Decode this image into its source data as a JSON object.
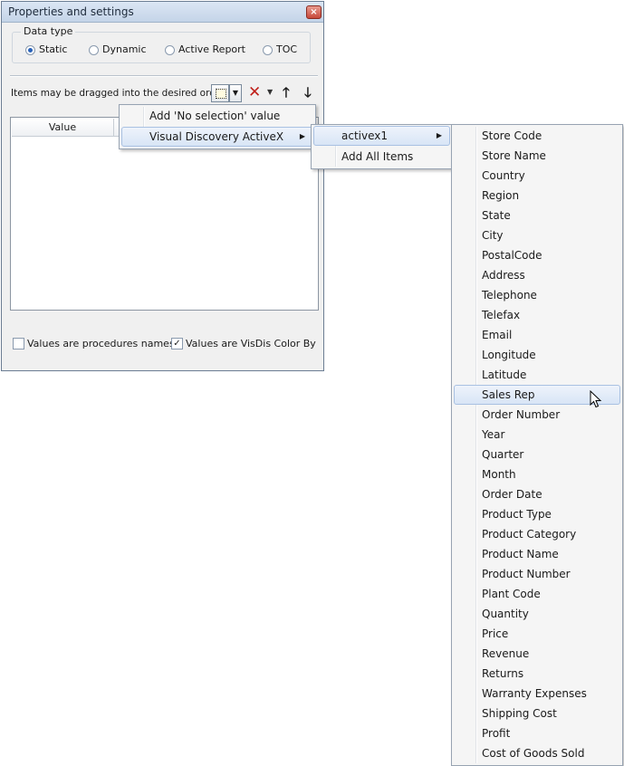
{
  "dialog": {
    "title": "Properties and settings",
    "close_glyph": "×",
    "data_type": {
      "label": "Data type",
      "options": [
        {
          "label": "Static",
          "selected": true
        },
        {
          "label": "Dynamic",
          "selected": false
        },
        {
          "label": "Active Report",
          "selected": false
        },
        {
          "label": "TOC",
          "selected": false
        }
      ]
    },
    "hint": "Items may be dragged into the desired order",
    "toolbar": {
      "add_icon": "add-item-icon",
      "dropdown_glyph": "▼",
      "delete_glyph": "✕",
      "delete_arrow_glyph": "▼",
      "up_glyph": "🡑",
      "down_glyph": "🡓"
    },
    "grid": {
      "column_value": "Value"
    },
    "checkbox_procedures": {
      "label": "Values are procedures names",
      "checked": false
    },
    "checkbox_visdis": {
      "label": "Values are VisDis Color By",
      "checked": true,
      "check_glyph": "✓"
    }
  },
  "menu1": {
    "items": [
      {
        "label": "Add 'No selection' value",
        "has_submenu": false,
        "highlighted": false
      },
      {
        "label": "Visual Discovery ActiveX",
        "has_submenu": true,
        "highlighted": true
      }
    ],
    "submenu_glyph": "▶"
  },
  "menu2": {
    "items": [
      {
        "label": "activex1",
        "has_submenu": true,
        "highlighted": true
      },
      {
        "label": "Add All Items",
        "has_submenu": false,
        "highlighted": false
      }
    ],
    "submenu_glyph": "▶"
  },
  "menu3": {
    "highlighted_index": 13,
    "items": [
      "Store Code",
      "Store Name",
      "Country",
      "Region",
      "State",
      "City",
      "PostalCode",
      "Address",
      "Telephone",
      "Telefax",
      "Email",
      "Longitude",
      "Latitude",
      "Sales Rep",
      "Order Number",
      "Year",
      "Quarter",
      "Month",
      "Order Date",
      "Product Type",
      "Product Category",
      "Product Name",
      "Product Number",
      "Plant Code",
      "Quantity",
      "Price",
      "Revenue",
      "Returns",
      "Warranty Expenses",
      "Shipping Cost",
      "Profit",
      "Cost of Goods Sold"
    ]
  },
  "colors": {
    "highlight": "#d8e5f6",
    "accent": "#2a62b8",
    "delete": "#c0201a"
  }
}
